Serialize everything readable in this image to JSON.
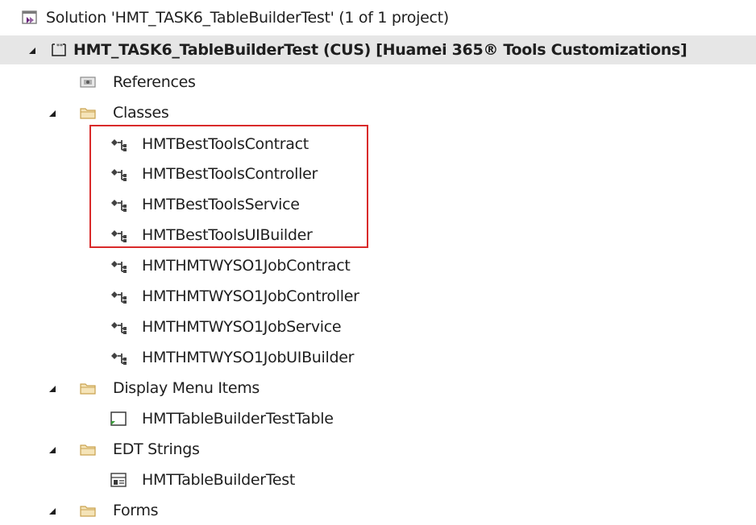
{
  "solution": {
    "label": "Solution 'HMT_TASK6_TableBuilderTest' (1 of 1 project)"
  },
  "project": {
    "label": "HMT_TASK6_TableBuilderTest (CUS) [Huamei 365® Tools Customizations]"
  },
  "nodes": {
    "references": "References",
    "classes": "Classes",
    "class_items": [
      "HMTBestToolsContract",
      "HMTBestToolsController",
      "HMTBestToolsService",
      "HMTBestToolsUIBuilder",
      "HMTHMTWYSO1JobContract",
      "HMTHMTWYSO1JobController",
      "HMTHMTWYSO1JobService",
      "HMTHMTWYSO1JobUIBuilder"
    ],
    "display_menu_items": "Display Menu Items",
    "display_menu_item_children": [
      "HMTTableBuilderTestTable"
    ],
    "edt_strings": "EDT Strings",
    "edt_string_children": [
      "HMTTableBuilderTest"
    ],
    "forms": "Forms"
  },
  "colors": {
    "highlight_border": "#d92a2a",
    "selected_row": "#e6e6e6",
    "folder": "#dcb67a",
    "class_icon": "#424242"
  }
}
